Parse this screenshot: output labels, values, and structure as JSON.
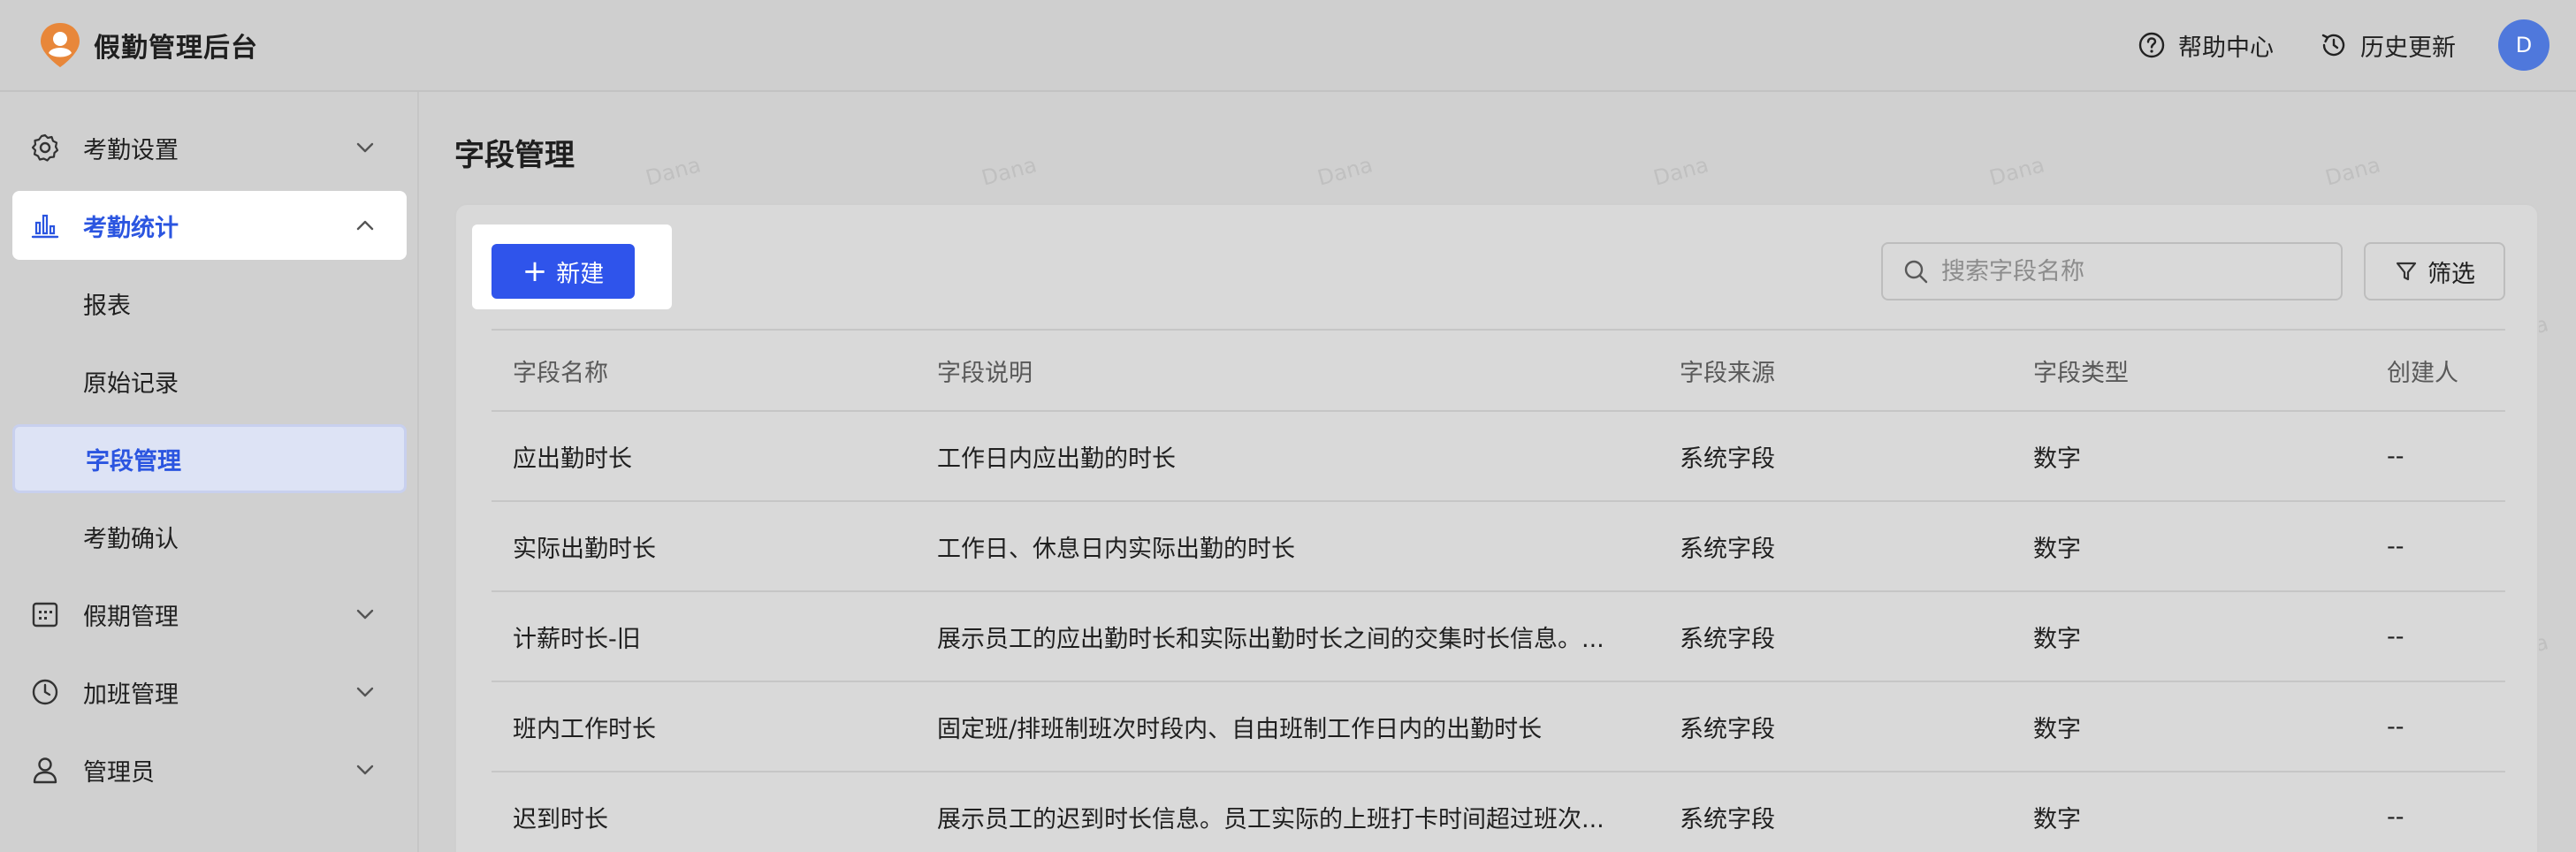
{
  "app": {
    "title": "假勤管理后台"
  },
  "header": {
    "help_label": "帮助中心",
    "history_label": "历史更新",
    "avatar_initial": "D"
  },
  "sidebar": {
    "items": [
      {
        "label": "考勤设置",
        "icon": "gear-icon",
        "expanded": false
      },
      {
        "label": "考勤统计",
        "icon": "bar-chart-icon",
        "expanded": true,
        "active": true,
        "children": [
          {
            "label": "报表"
          },
          {
            "label": "原始记录"
          },
          {
            "label": "字段管理",
            "selected": true
          },
          {
            "label": "考勤确认"
          }
        ]
      },
      {
        "label": "假期管理",
        "icon": "calendar-icon",
        "expanded": false
      },
      {
        "label": "加班管理",
        "icon": "clock-icon",
        "expanded": false
      },
      {
        "label": "管理员",
        "icon": "user-icon",
        "expanded": false
      }
    ]
  },
  "main": {
    "page_title": "字段管理",
    "new_button_label": "新建",
    "search_placeholder": "搜索字段名称",
    "filter_label": "筛选",
    "columns": [
      "字段名称",
      "字段说明",
      "字段来源",
      "字段类型",
      "创建人"
    ],
    "rows": [
      [
        "应出勤时长",
        "工作日内应出勤的时长",
        "系统字段",
        "数字",
        "--"
      ],
      [
        "实际出勤时长",
        "工作日、休息日内实际出勤的时长",
        "系统字段",
        "数字",
        "--"
      ],
      [
        "计薪时长-旧",
        "展示员工的应出勤时长和实际出勤时长之间的交集时长信息。...",
        "系统字段",
        "数字",
        "--"
      ],
      [
        "班内工作时长",
        "固定班/排班制班次时段内、自由班制工作日内的出勤时长",
        "系统字段",
        "数字",
        "--"
      ],
      [
        "迟到时长",
        "展示员工的迟到时长信息。员工实际的上班打卡时间超过班次...",
        "系统字段",
        "数字",
        "--"
      ]
    ]
  },
  "watermark": "Dana",
  "colors": {
    "accent": "#2f54eb",
    "active_text": "#2b55e0",
    "avatar": "#4f78dc"
  }
}
